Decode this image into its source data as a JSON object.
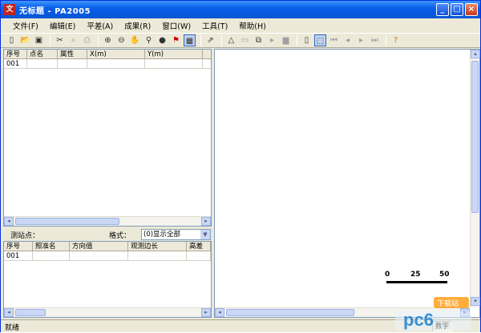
{
  "window": {
    "title": "无标题 - PA2005",
    "app_icon_text": "文",
    "min_glyph": "_",
    "max_glyph": "□",
    "close_glyph": "×"
  },
  "menu": [
    "文件(F)",
    "编辑(E)",
    "平差(A)",
    "成果(R)",
    "窗口(W)",
    "工具(T)",
    "帮助(H)"
  ],
  "toolbar": {
    "icons": [
      "new-file-icon",
      "open-file-icon",
      "save-icon",
      "sep",
      "tools-icon",
      "print-preview-icon",
      "print-icon",
      "sep",
      "zoom-in-icon",
      "zoom-out-icon",
      "pan-hand-icon",
      "zoom-window-icon",
      "globe-icon",
      "flag-icon",
      "grid-view-icon",
      "sep",
      "export-icon",
      "sep",
      "triangle-icon",
      "folder-icon",
      "network-icon",
      "play-icon",
      "chart-icon",
      "sep",
      "page-icon",
      "select-icon",
      "first-icon",
      "prev-icon",
      "next-icon",
      "last-icon",
      "sep",
      "help-icon"
    ]
  },
  "points_table": {
    "headers": [
      "序号",
      "点名",
      "属性",
      "X(m)",
      "Y(m)"
    ],
    "rows": [
      [
        "001",
        "",
        "",
        "",
        ""
      ]
    ]
  },
  "station_bar": {
    "station_label": "测站点：",
    "format_label": "格式：",
    "format_value": "(0)显示全部"
  },
  "obs_table": {
    "headers": [
      "序号",
      "照准名",
      "方向值",
      "观测边长",
      "高差"
    ],
    "rows": [
      [
        "001",
        "",
        "",
        "",
        ""
      ]
    ]
  },
  "scale": {
    "labels": [
      "0",
      "25",
      "50"
    ]
  },
  "status": {
    "text": "就绪",
    "mode": "数字"
  },
  "watermark": {
    "brand": "pc6",
    "sub": "下载站"
  }
}
